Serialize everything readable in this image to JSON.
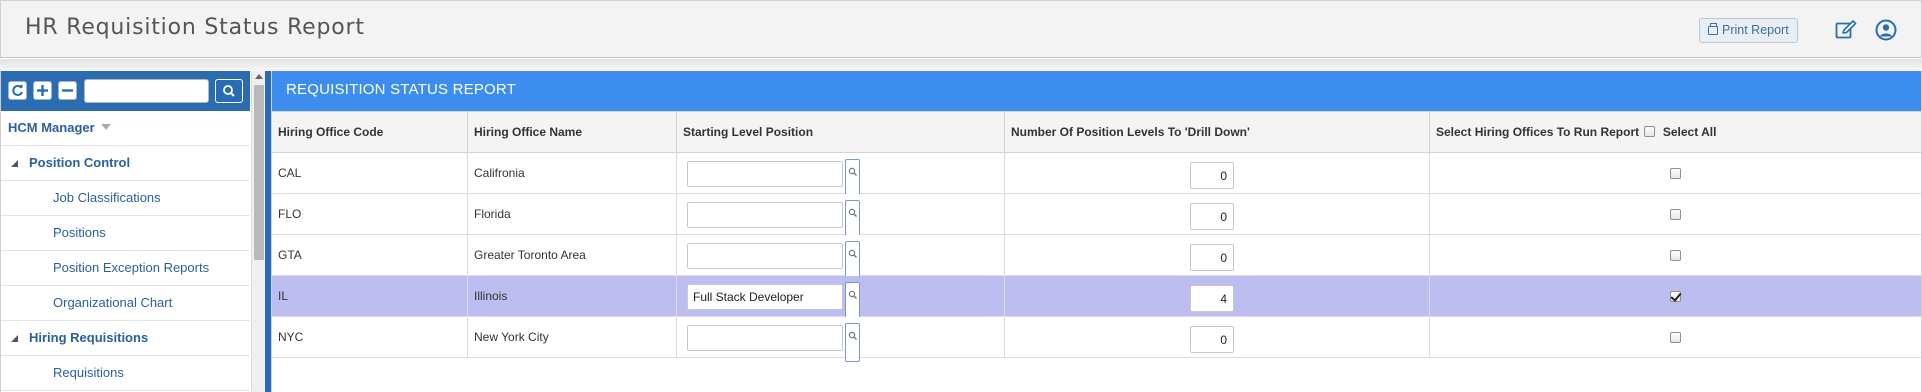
{
  "header": {
    "title": "HR Requisition Status Report",
    "print_label": "Print Report"
  },
  "sidebar": {
    "search_value": "",
    "items": [
      {
        "label": "HCM Manager",
        "level": 0
      },
      {
        "label": "Position Control",
        "level": 1
      },
      {
        "label": "Job Classifications",
        "level": 2
      },
      {
        "label": "Positions",
        "level": 2
      },
      {
        "label": "Position Exception Reports",
        "level": 2
      },
      {
        "label": "Organizational Chart",
        "level": 2
      },
      {
        "label": "Hiring Requisitions",
        "level": 1
      },
      {
        "label": "Requisitions",
        "level": 2
      }
    ]
  },
  "panel": {
    "title": "REQUISITION STATUS REPORT"
  },
  "grid": {
    "columns": {
      "code": "Hiring Office Code",
      "name": "Hiring Office Name",
      "start": "Starting Level Position",
      "levels": "Number Of Position Levels To 'Drill Down'",
      "select": "Select Hiring Offices To Run Report",
      "select_all": "Select All"
    },
    "select_all_checked": false,
    "rows": [
      {
        "code": "CAL",
        "name": "Califronia",
        "start": "",
        "levels": "0",
        "selected": false,
        "highlight": false
      },
      {
        "code": "FLO",
        "name": "Florida",
        "start": "",
        "levels": "0",
        "selected": false,
        "highlight": false
      },
      {
        "code": "GTA",
        "name": "Greater Toronto Area",
        "start": "",
        "levels": "0",
        "selected": false,
        "highlight": false
      },
      {
        "code": "IL",
        "name": "Illinois",
        "start": "Full Stack Developer",
        "levels": "4",
        "selected": true,
        "highlight": true
      },
      {
        "code": "NYC",
        "name": "New York City",
        "start": "",
        "levels": "0",
        "selected": false,
        "highlight": false
      }
    ]
  },
  "colors": {
    "panel_header": "#3c8ded",
    "toolbar": "#2b6cb0",
    "selected_row": "#bdbdf2",
    "link": "#2b5f9e"
  }
}
